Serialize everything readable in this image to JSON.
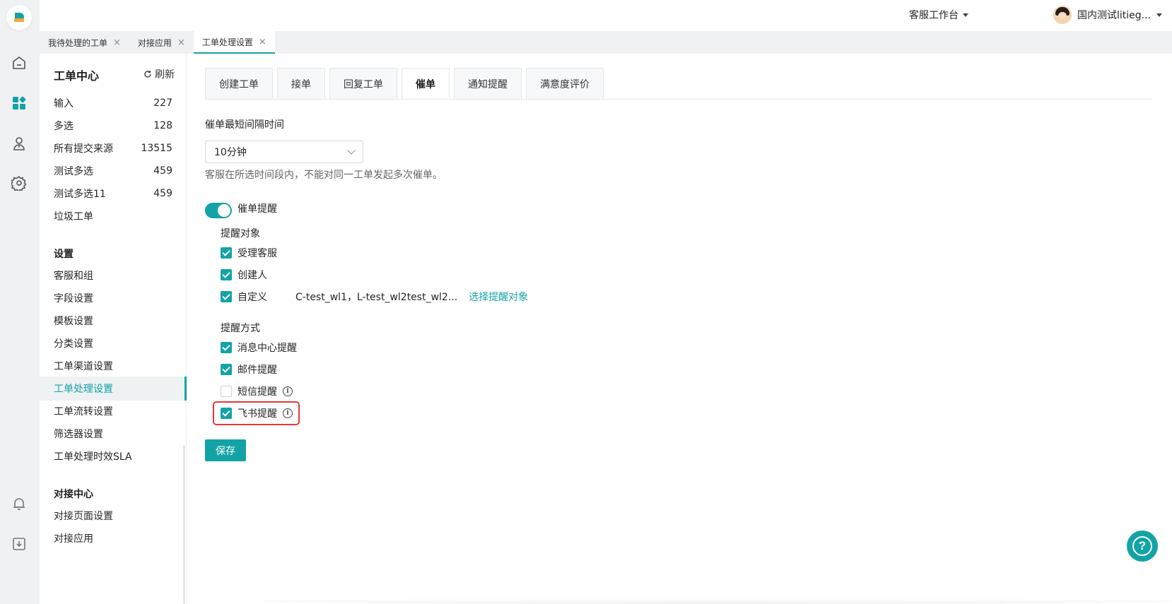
{
  "header": {
    "workbench_label": "客服工作台",
    "user_name": "国内测试litieg..."
  },
  "page_tabs": [
    {
      "label": "我待处理的工单"
    },
    {
      "label": "对接应用"
    },
    {
      "label": "工单处理设置"
    }
  ],
  "close_glyph": "×",
  "nav": {
    "title": "工单中心",
    "refresh_label": "刷新",
    "views": [
      {
        "label": "输入",
        "count": "227"
      },
      {
        "label": "多选",
        "count": "128"
      },
      {
        "label": "所有提交来源",
        "count": "13515"
      },
      {
        "label": "测试多选",
        "count": "459"
      },
      {
        "label": "测试多选11",
        "count": "459"
      },
      {
        "label": "垃圾工单",
        "count": ""
      }
    ],
    "settings_title": "设置",
    "settings": [
      {
        "label": "客服和组"
      },
      {
        "label": "字段设置"
      },
      {
        "label": "模板设置"
      },
      {
        "label": "分类设置"
      },
      {
        "label": "工单渠道设置"
      },
      {
        "label": "工单处理设置"
      },
      {
        "label": "工单流转设置"
      },
      {
        "label": "筛选器设置"
      },
      {
        "label": "工单处理时效SLA"
      }
    ],
    "integration_title": "对接中心",
    "integration": [
      {
        "label": "对接页面设置"
      },
      {
        "label": "对接应用"
      }
    ]
  },
  "content_tabs": [
    {
      "label": "创建工单"
    },
    {
      "label": "接单"
    },
    {
      "label": "回复工单"
    },
    {
      "label": "催单"
    },
    {
      "label": "通知提醒"
    },
    {
      "label": "满意度评价"
    }
  ],
  "urge": {
    "interval_label": "催单最短间隔时间",
    "interval_value": "10分钟",
    "interval_hint": "客服在所选时间段内，不能对同一工单发起多次催单。",
    "reminder_toggle_label": "催单提醒",
    "reminder_toggle_on": true,
    "targets_title": "提醒对象",
    "targets": [
      {
        "label": "受理客服",
        "checked": true
      },
      {
        "label": "创建人",
        "checked": true
      },
      {
        "label": "自定义",
        "checked": true
      }
    ],
    "custom_targets_value": "C-test_wl1，L-test_wl2test_wl2...",
    "select_targets_link": "选择提醒对象",
    "methods_title": "提醒方式",
    "methods": [
      {
        "label": "消息中心提醒",
        "checked": true
      },
      {
        "label": "邮件提醒",
        "checked": true
      },
      {
        "label": "短信提醒",
        "checked": false
      },
      {
        "label": "飞书提醒",
        "checked": true
      }
    ],
    "save_label": "保存"
  },
  "help_glyph": "?",
  "colors": {
    "accent": "#13a3a6",
    "highlight_border": "#e53935"
  }
}
